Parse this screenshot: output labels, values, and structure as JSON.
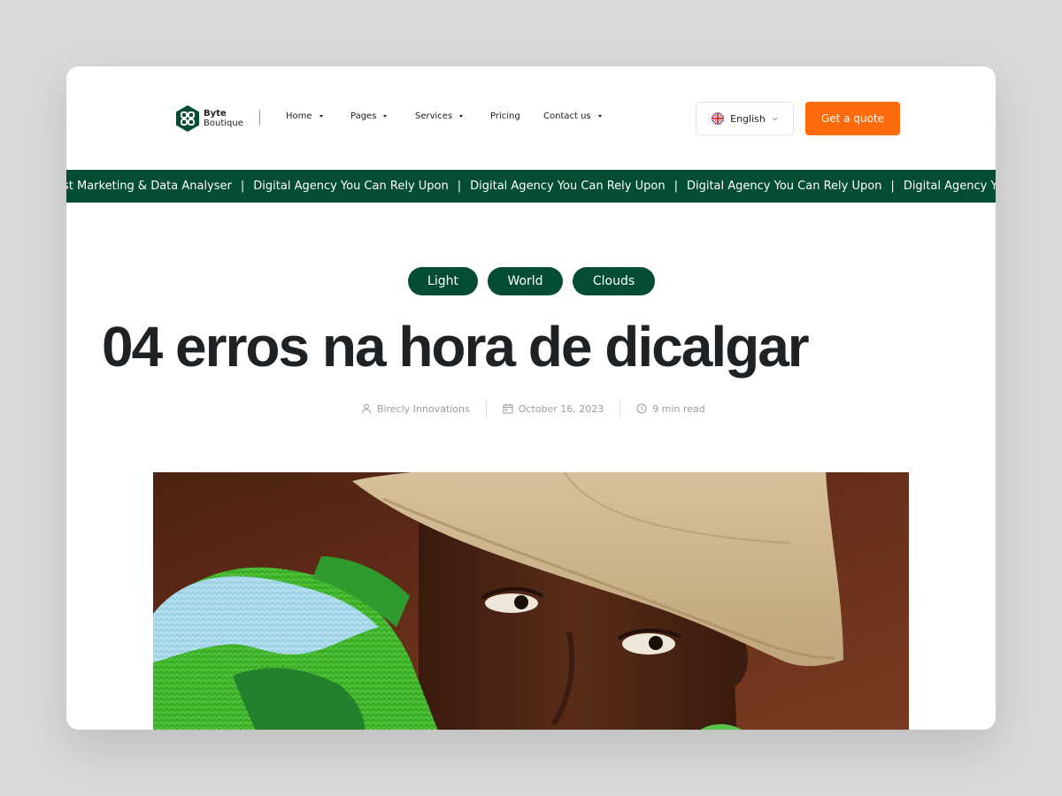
{
  "colors": {
    "brand_green": "#034c36",
    "accent_orange": "#ff6a0a",
    "page_bg": "#d9d9d9"
  },
  "logo": {
    "line1": "Byte",
    "line2": "Boutique",
    "icon": "hexagon-logo-icon"
  },
  "nav": {
    "items": [
      {
        "label": "Home",
        "has_dropdown": true
      },
      {
        "label": "Pages",
        "has_dropdown": true
      },
      {
        "label": "Services",
        "has_dropdown": true
      },
      {
        "label": "Pricing",
        "has_dropdown": false
      },
      {
        "label": "Contact us",
        "has_dropdown": true
      }
    ]
  },
  "language": {
    "label": "English",
    "icon": "uk-flag-icon"
  },
  "cta": {
    "label": "Get a quote"
  },
  "ticker": {
    "items": [
      "est Marketing & Data Analyser",
      "Digital Agency You Can Rely Upon",
      "Digital Agency You Can Rely Upon",
      "Digital Agency You Can Rely Upon",
      "Digital Agency You Can Re"
    ],
    "separator": "|"
  },
  "post": {
    "tags": [
      "Light",
      "World",
      "Clouds"
    ],
    "title": "04 erros na hora de dicalgar",
    "author": "Birecly Innovations",
    "date": "October 16, 2023",
    "read_time": "9 min read"
  }
}
